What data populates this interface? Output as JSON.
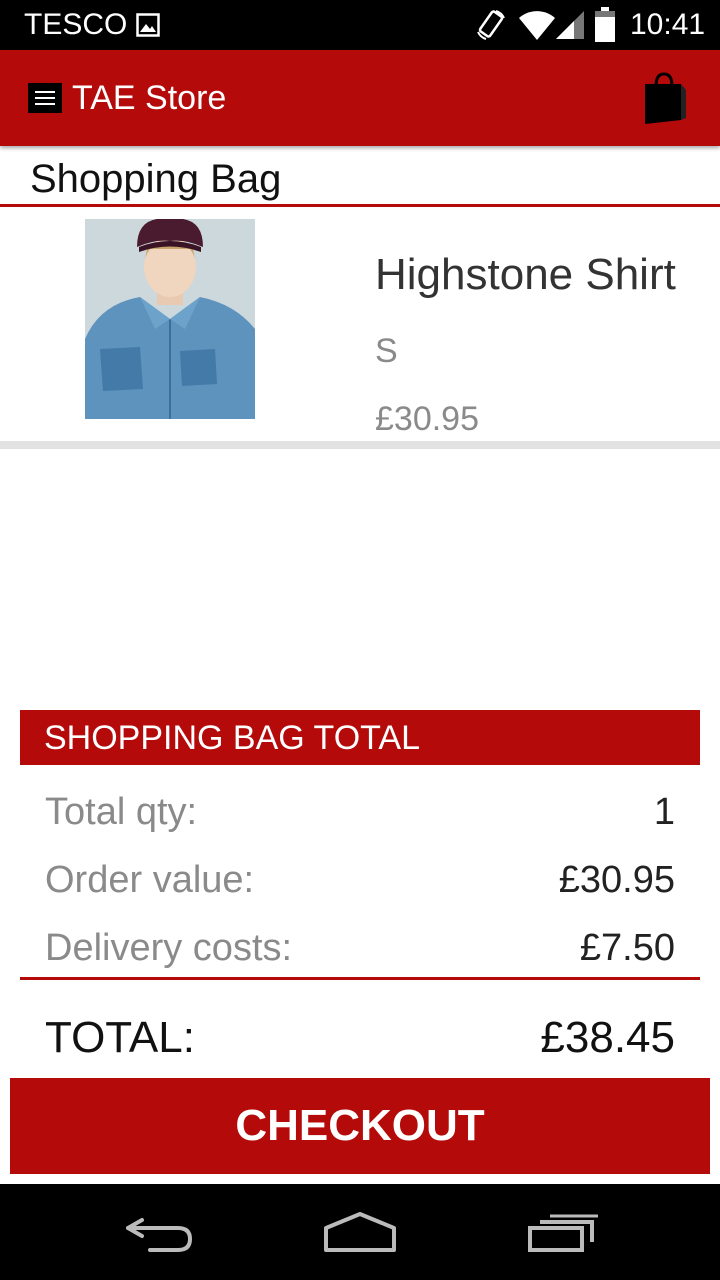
{
  "status_bar": {
    "carrier": "TESCO",
    "time": "10:41",
    "icons": [
      "image-icon",
      "screen-rotation-icon",
      "wifi-icon",
      "signal-icon",
      "battery-icon"
    ]
  },
  "app_bar": {
    "title": "TAE Store",
    "icons": [
      "menu-icon",
      "shopping-bag-icon"
    ]
  },
  "page": {
    "title": "Shopping Bag"
  },
  "cart": {
    "items": [
      {
        "name": "Highstone Shirt",
        "size": "S",
        "price": "£30.95"
      }
    ]
  },
  "summary": {
    "header": "SHOPPING BAG TOTAL",
    "rows": [
      {
        "label": "Total qty:",
        "value": "1"
      },
      {
        "label": "Order value:",
        "value": "£30.95"
      },
      {
        "label": "Delivery costs:",
        "value": "£7.50"
      }
    ],
    "total_label": "TOTAL:",
    "total_value": "£38.45"
  },
  "checkout": {
    "label": "CHECKOUT"
  },
  "nav_bar": {
    "icons": [
      "back-icon",
      "home-icon",
      "recent-apps-icon"
    ]
  },
  "colors": {
    "brand_red": "#b50a0a",
    "status_bar": "#000000",
    "muted_text": "#8a8a8a"
  }
}
